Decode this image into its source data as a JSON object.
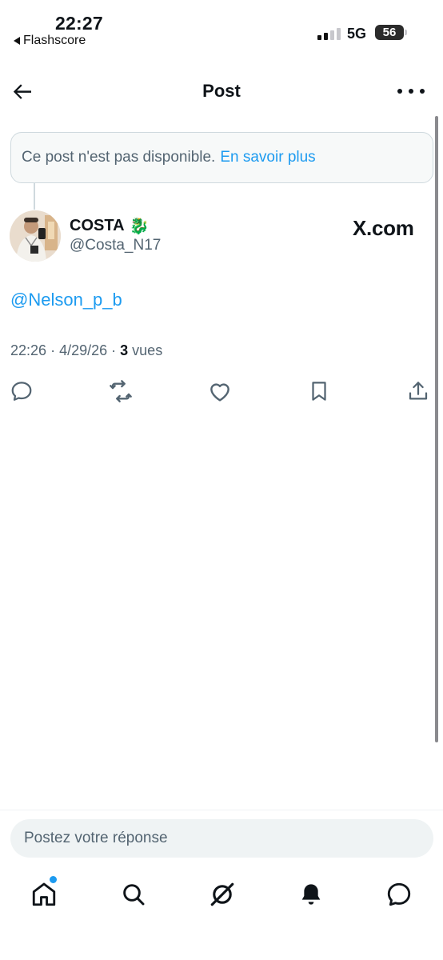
{
  "status_bar": {
    "time": "22:27",
    "back_app": "Flashscore",
    "network": "5G",
    "battery": "56"
  },
  "header": {
    "title": "Post"
  },
  "unavailable_notice": {
    "text": "Ce post n'est pas disponible.",
    "link": "En savoir plus"
  },
  "post": {
    "author_name": "COSTA",
    "author_emoji": "🐉",
    "author_handle": "@Costa_N17",
    "source_badge": "X.com",
    "text": "@Nelson_p_b",
    "time": "22:26",
    "date": "4/29/26",
    "views_count": "3",
    "views_label": "vues"
  },
  "reply": {
    "placeholder": "Postez votre réponse"
  },
  "icons": {
    "back": "arrow-left-icon",
    "more": "more-horizontal-icon",
    "reply": "comment-icon",
    "repost": "repost-icon",
    "like": "heart-icon",
    "bookmark": "bookmark-icon",
    "share": "share-icon",
    "nav": [
      "home-icon",
      "search-icon",
      "grok-icon",
      "bell-icon",
      "messages-icon"
    ]
  },
  "colors": {
    "accent": "#1d9bf0",
    "text_primary": "#0f1419",
    "text_secondary": "#536471"
  }
}
